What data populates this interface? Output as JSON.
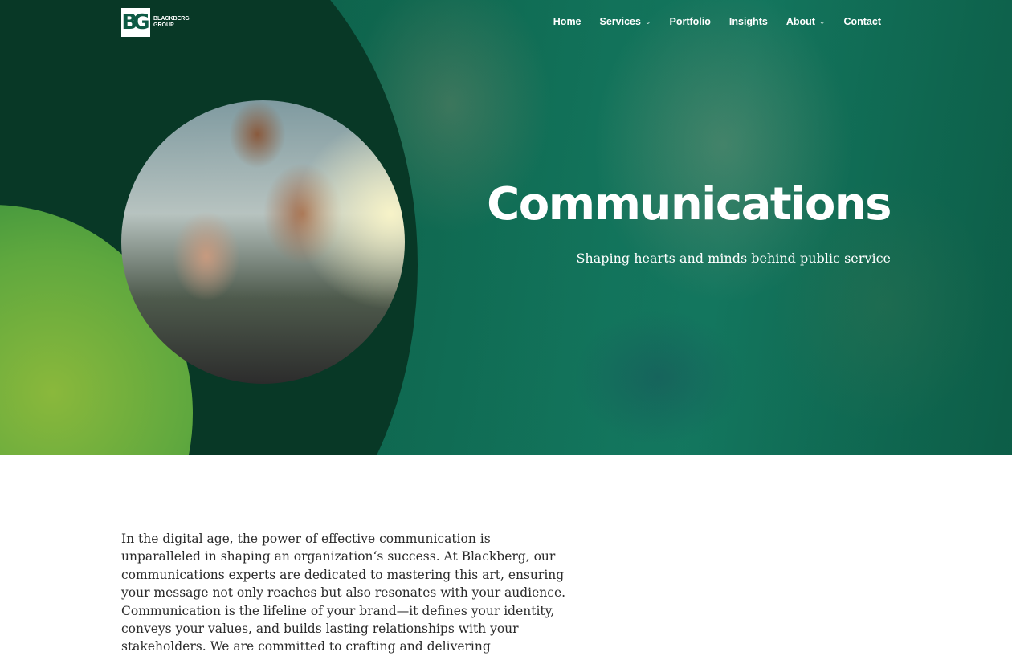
{
  "brand": {
    "logo_text_line1": "BLACKBERG",
    "logo_text_line2": "GROUP",
    "logo_glyph": "BG"
  },
  "nav": {
    "items": [
      {
        "label": "Home",
        "has_dropdown": false
      },
      {
        "label": "Services",
        "has_dropdown": true
      },
      {
        "label": "Portfolio",
        "has_dropdown": false
      },
      {
        "label": "Insights",
        "has_dropdown": false
      },
      {
        "label": "About",
        "has_dropdown": true
      },
      {
        "label": "Contact",
        "has_dropdown": false
      }
    ]
  },
  "hero": {
    "title": "Communications",
    "subtitle": "Shaping hearts and minds behind public service"
  },
  "content": {
    "intro": "In the digital age, the power of effective communication is unparalleled in shaping an organization‘s success. At Blackberg, our communications experts are dedicated to mastering this art, ensuring your message not only reaches but also resonates with your audience. Communication is the lifeline of your brand—it defines your identity, conveys your values, and builds lasting relationships with your stakeholders. We are committed to crafting and delivering"
  },
  "colors": {
    "hero_green": "#0f6a51",
    "dark_green": "#083826",
    "lime": "#8ab83c",
    "text": "#2b2b2b"
  }
}
